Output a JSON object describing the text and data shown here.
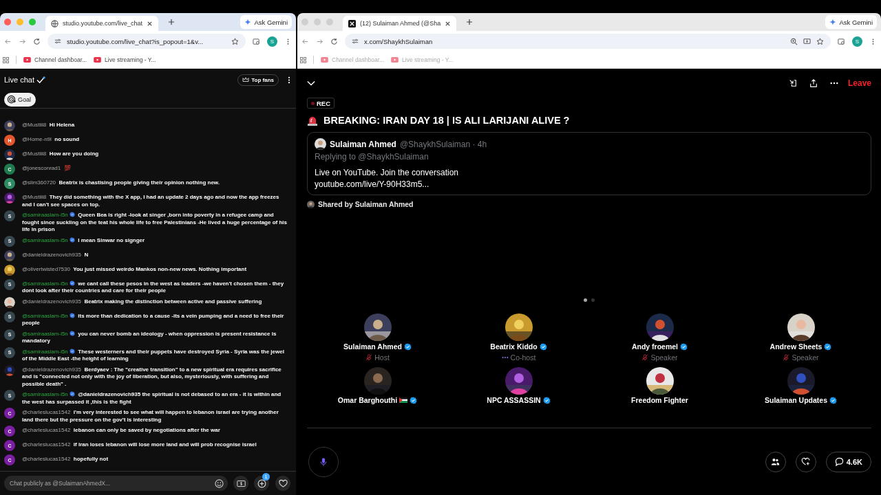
{
  "browsers": [
    {
      "active": true,
      "favicon": {
        "kind": "globe"
      },
      "tab_title": "studio.youtube.com/live_chat",
      "url": "studio.youtube.com/live_chat?is_popout=1&v...",
      "profile": "S",
      "ask": "Ask Gemini",
      "bookmarks": [
        "Channel dashboar...",
        "Live streaming - Y..."
      ]
    },
    {
      "active": false,
      "favicon": {
        "kind": "x"
      },
      "tab_title": "(12) Sulaiman Ahmed (@Sha",
      "url": "x.com/ShaykhSulaiman",
      "profile": "S",
      "ask": "Ask Gemini",
      "bookmarks": [
        "Channel dashboar...",
        "Live streaming - Y..."
      ]
    }
  ],
  "chat": {
    "title": "Live chat",
    "top_fans": "Top fans",
    "goal": "Goal",
    "placeholder": "Chat publicly as @SulaimanAhmedX...",
    "gift_count": "1",
    "messages": [
      {
        "author": "@Mustiii8",
        "verified": false,
        "text": "Hi Helena"
      },
      {
        "author": "@Home-n9l",
        "verified": false,
        "avatar": {
          "kind": "letter",
          "letter": "H",
          "color": "#e4572e"
        },
        "text": "no sound"
      },
      {
        "author": "@Mustiii8",
        "verified": false,
        "text": "How are you doing"
      },
      {
        "author": "@jonesconrad1",
        "verified": false,
        "avatar": {
          "kind": "letter",
          "letter": "C",
          "color": "#1f7a4f"
        },
        "text": "💯"
      },
      {
        "author": "@slim360720",
        "verified": false,
        "avatar": {
          "kind": "letter",
          "letter": "S",
          "color": "#2e8b64"
        },
        "text": "Beatrix is chastising people giving their opinion nothing new."
      },
      {
        "author": "@Mustiii8",
        "verified": false,
        "text": "They did something with the X app, I had an update 2 days ago and now the app freezes and I can't see spaces on top."
      },
      {
        "author": "@samiraaslam-i5n",
        "verified": true,
        "avatar": {
          "kind": "letter",
          "letter": "S",
          "color": "#37474f"
        },
        "text": "Queen Bea is right -look at singer ,born into poverty in a refugee camp and fought since suckling on the teat his whole life to free Palestinians -He lived a huge percentage of his life in prison"
      },
      {
        "author": "@samiraaslam-i5n",
        "verified": true,
        "avatar": {
          "kind": "letter",
          "letter": "S",
          "color": "#37474f"
        },
        "text": "I mean Sinwar no signger"
      },
      {
        "author": "@danieldrazenovich935",
        "verified": false,
        "text": "N"
      },
      {
        "author": "@olivertwisted7530",
        "verified": false,
        "text": "You just missed weirdo Mankos non-new news. Nothing important"
      },
      {
        "author": "@samiraaslam-i5n",
        "verified": true,
        "avatar": {
          "kind": "letter",
          "letter": "S",
          "color": "#37474f"
        },
        "text": "we cant call these pesos in the west as leaders -we haven't chosen them - they dont look after their countries and care for their people"
      },
      {
        "author": "@danieldrazenovich935",
        "verified": false,
        "text": "Beatrix making the distinction between active and passive suffering"
      },
      {
        "author": "@samiraaslam-i5n",
        "verified": true,
        "avatar": {
          "kind": "letter",
          "letter": "S",
          "color": "#37474f"
        },
        "text": "its more than dedication to a cause -its a vein pumping and a need to free their people"
      },
      {
        "author": "@samiraaslam-i5n",
        "verified": true,
        "avatar": {
          "kind": "letter",
          "letter": "S",
          "color": "#37474f"
        },
        "text": "you can never bomb an ideology - when oppression is present resistance is mandatory"
      },
      {
        "author": "@samiraaslam-i5n",
        "verified": true,
        "avatar": {
          "kind": "letter",
          "letter": "S",
          "color": "#37474f"
        },
        "text": "These westerners and their puppets have destroyed Syria - Syria was the jewel of the Middle East -the height of learning"
      },
      {
        "author": "@danieldrazenovich935",
        "verified": false,
        "text": "Berdyaev : The \"creative transition\" to a new spiritual era requires sacrifice and is \"connected not only with the joy of liberation, but also, mysteriously, with suffering and possible death\" ."
      },
      {
        "author": "@samiraaslam-i5n",
        "verified": true,
        "avatar": {
          "kind": "letter",
          "letter": "S",
          "color": "#37474f"
        },
        "text": "@danieldrazenovich935 the spiritual is not debased to an era - it is within and the west has surpassed it ,this is the fight"
      },
      {
        "author": "@charleslucas1542",
        "verified": false,
        "avatar": {
          "kind": "letter",
          "letter": "C",
          "color": "#7b1fa2"
        },
        "text": "i'm very interested to see what will happen to lebanon israel are trying another land there but the pressure on the gov't is interesting"
      },
      {
        "author": "@charleslucas1542",
        "verified": false,
        "avatar": {
          "kind": "letter",
          "letter": "C",
          "color": "#7b1fa2"
        },
        "text": "lebanon can only be saved by negotiations after the war"
      },
      {
        "author": "@charleslucas1542",
        "verified": false,
        "avatar": {
          "kind": "letter",
          "letter": "C",
          "color": "#7b1fa2"
        },
        "text": "if iran loses lebanon will lose more land and will prob recognise israel"
      },
      {
        "author": "@charleslucas1542",
        "verified": false,
        "avatar": {
          "kind": "letter",
          "letter": "C",
          "color": "#7b1fa2"
        },
        "text": "hopefully not"
      }
    ]
  },
  "space": {
    "leave": "Leave",
    "rec": "REC",
    "title": "BREAKING: IRAN DAY 18 | IS ALI LARIJANI ALIVE ?",
    "post": {
      "name": "Sulaiman Ahmed",
      "handle": "@ShaykhSulaiman · 4h",
      "replying": "Replying to @ShaykhSulaiman",
      "text": "Live on YouTube. Join the conversation",
      "link": "youtube.com/live/Y-90H33m5..."
    },
    "shared_by": "Shared by Sulaiman Ahmed",
    "speakers": [
      {
        "name": "Sulaiman Ahmed",
        "verified": true,
        "role": "Host",
        "role_icon": {
          "kind": "muted"
        }
      },
      {
        "name": "Beatrix Kiddo",
        "verified": true,
        "role": "Co-host",
        "role_icon": {
          "kind": "dots"
        }
      },
      {
        "name": "Andy froemel",
        "verified": true,
        "role": "Speaker",
        "role_icon": {
          "kind": "muted"
        }
      },
      {
        "name": "Andrew Sheets",
        "verified": true,
        "role": "Speaker",
        "role_icon": {
          "kind": "muted"
        }
      },
      {
        "name": "Omar Barghouthi",
        "verified": true,
        "flag": true
      },
      {
        "name": "NPC ASSASSIN",
        "verified": true
      },
      {
        "name": "Freedom Fighter",
        "verified": false
      },
      {
        "name": "Sulaiman Updates",
        "verified": true
      }
    ],
    "comments": "4.6K"
  }
}
